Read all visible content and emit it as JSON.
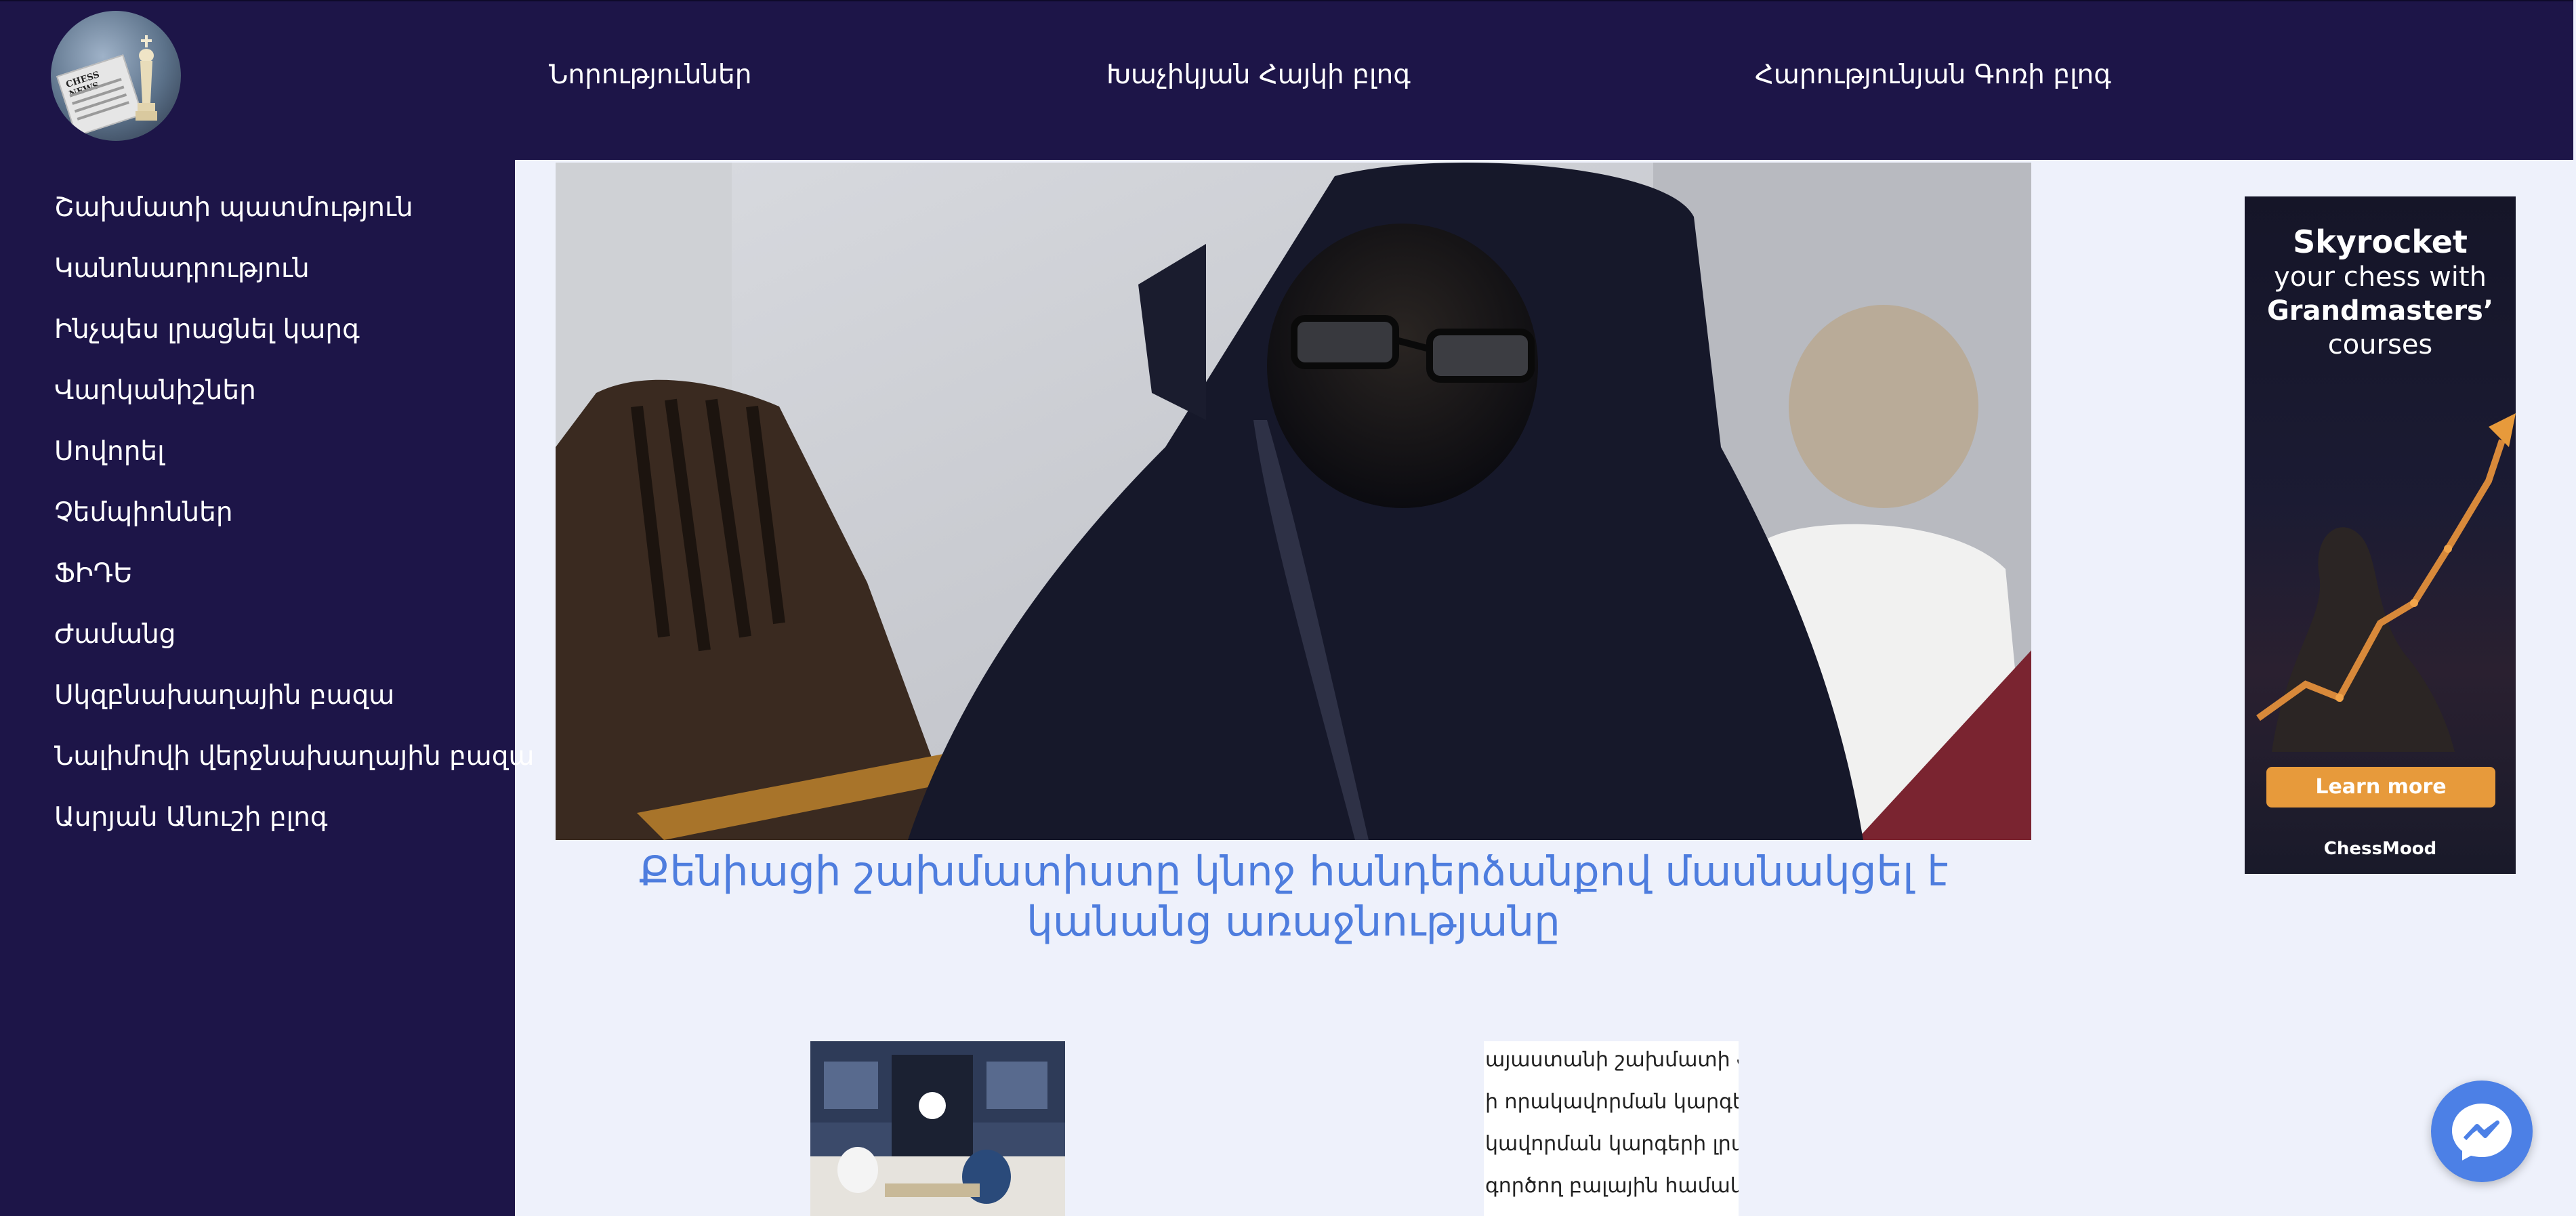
{
  "logo": {
    "caption": "CHESS NEWS"
  },
  "top_nav": {
    "items": [
      {
        "label": "Նորություններ"
      },
      {
        "label": "Խաչիկյան Հայկի բլոգ"
      },
      {
        "label": "Հարությունյան Գոռի բլոգ"
      }
    ]
  },
  "sidebar": {
    "items": [
      {
        "label": "Շախմատի պատմություն"
      },
      {
        "label": "Կանոնադրություն"
      },
      {
        "label": "Ինչպես լրացնել կարգ"
      },
      {
        "label": "Վարկանիշներ"
      },
      {
        "label": "Սովորել"
      },
      {
        "label": "Չեմպիոններ"
      },
      {
        "label": "ՖԻԴԵ"
      },
      {
        "label": "Ժամանց"
      },
      {
        "label": "Սկզբնախաղային բազա"
      },
      {
        "label": "Նալիմովի վերջնախաղային բազա"
      },
      {
        "label": "Ասրյան Անուշի բլոգ"
      }
    ]
  },
  "main": {
    "headline": "Քենիացի շախմատիստը կնոջ հանդերձանքով մասնակցել է կանանց առաջնությանը"
  },
  "ad": {
    "line1": "Skyrocket",
    "line2": "your chess with",
    "line3": "Grandmasters’",
    "line4": "courses",
    "button": "Learn more",
    "brand": "ChessMood"
  },
  "article_preview": {
    "lines": [
      "այաստանի շախմատի ֆե",
      "ի որակավորման կարգերի",
      "կավորման կարգերի լրա",
      "գործող բալային համակար"
    ]
  },
  "colors": {
    "nav_bg": "#1d1548",
    "page_bg": "#eef1fb",
    "headline": "#4e7dde",
    "ad_button": "#e79a3b",
    "messenger": "#4c80e6"
  },
  "icons": {
    "messenger": "messenger-icon",
    "logo": "chess-news-logo"
  }
}
